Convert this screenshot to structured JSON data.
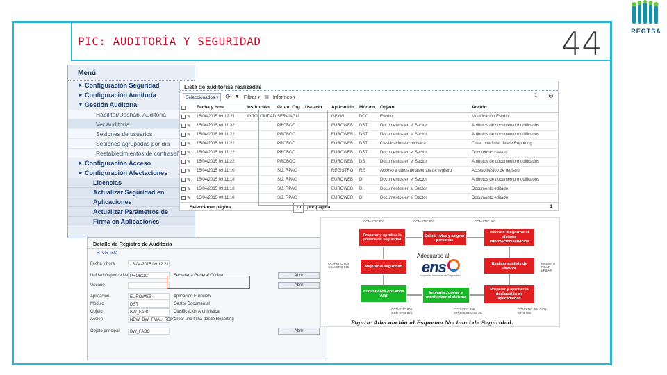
{
  "slide": {
    "title": "PIC: AUDITORÍA Y SEGURIDAD",
    "page_number": "44",
    "logo_text": "REGTSA",
    "colors": {
      "frame": "#2bb6d4",
      "title": "#c4122f"
    }
  },
  "menu": {
    "title": "Menú",
    "items": [
      {
        "label": "Configuración Seguridad",
        "type": "collapsed"
      },
      {
        "label": "Configuración Auditoría",
        "type": "collapsed"
      },
      {
        "label": "Gestión Auditoría",
        "type": "expanded"
      },
      {
        "label": "Habilitar/Deshab. Auditoría",
        "type": "sub"
      },
      {
        "label": "Ver Auditoría",
        "type": "sub-selected"
      },
      {
        "label": "Sesiones de usuarios",
        "type": "sub"
      },
      {
        "label": "Sesiones agrupadas por día",
        "type": "sub"
      },
      {
        "label": "Restablecimientos de contraseña",
        "type": "sub"
      },
      {
        "label": "Configuración Acceso",
        "type": "collapsed"
      },
      {
        "label": "Configuración Afectaciones",
        "type": "collapsed"
      },
      {
        "label": "Licencias",
        "type": "plain"
      },
      {
        "label": "Actualizar Seguridad en",
        "type": "plain"
      },
      {
        "label": "Aplicaciones",
        "type": "plain"
      },
      {
        "label": "Actualizar Parámetros de",
        "type": "plain"
      },
      {
        "label": "Firma en Aplicaciones",
        "type": "plain"
      }
    ]
  },
  "audit_list": {
    "title": "Lista de auditorías realizadas",
    "toolbar": {
      "select_label": "Seleccionados ▾",
      "filter_label": "Filtrar ▾",
      "reports_label": "Informes ▾",
      "page": "1",
      "gear_icon": "gear-icon"
    },
    "columns": [
      "Fecha y hora",
      "Institución",
      "Grupo Org.",
      "Usuario",
      "Aplicación",
      "Módulo",
      "Objeto",
      "Acción"
    ],
    "rows": [
      [
        "15/04/2015 09:12:21",
        "AYTO. CIUDAD",
        "SERVIAGUI",
        "",
        "GEYW",
        "DOC",
        "Escrito",
        "Modificación Escrito"
      ],
      [
        "15/04/2015 09:11:32",
        "",
        "PROBOC",
        "",
        "EUROWEB",
        "DST",
        "Documentos en el Sector",
        "Atributos de documento modificados"
      ],
      [
        "15/04/2015 09:11:22",
        "",
        "PROBOC",
        "",
        "EUROWEB",
        "DST",
        "Documentos en el Sector",
        "Atributos de documento modificados"
      ],
      [
        "15/04/2015 09:11:22",
        "",
        "PROBOC",
        "",
        "EUROWEB",
        "DST",
        "Clasificación Archivística",
        "Crear una ficha desde Reporting"
      ],
      [
        "15/04/2015 09:11:22",
        "",
        "PROBOC",
        "",
        "EUROWEB",
        "DST",
        "Documentos en el Sector",
        "Documento creado"
      ],
      [
        "15/04/2015 09:11:22",
        "",
        "PROBOC",
        "",
        "EUROWEB",
        "DS",
        "Documentos en el Sector",
        "Atributos de documento modificados"
      ],
      [
        "15/04/2015 09:11:10",
        "",
        "SIJ. RPAC",
        "",
        "REGISTRO",
        "RE",
        "Acceso a datos de asientos de registro",
        "Acceso básico de registro"
      ],
      [
        "15/04/2015 09:11:18",
        "",
        "SIJ. RPAC",
        "",
        "EUROWEB",
        "DI",
        "Documentos en el Sector",
        "Atributos de documento modificados"
      ],
      [
        "15/04/2015 09:11:18",
        "",
        "SIJ. RPAC",
        "",
        "EUROWEB",
        "DI",
        "Documentos en el Sector",
        "Documento editado"
      ],
      [
        "15/04/2015 09:11:18",
        "",
        "SIJ. RPAC",
        "",
        "EUROWEB",
        "DI",
        "Documentos en el Sector",
        "Documento editado"
      ]
    ],
    "footer": {
      "select_pages_label": "Seleccionar página",
      "per_page_value": "10",
      "per_page_label": "por página",
      "page": "1"
    }
  },
  "detail": {
    "title": "Detalle de Registro de Auditoría",
    "back_label": "Ver lista",
    "fields": [
      {
        "label": "Fecha y hora",
        "value": "15-04-2015 09:12:21",
        "desc": ""
      },
      {
        "label": "Unidad Organizativa",
        "value": "PROBOC",
        "desc": "Secretaría General Oficina",
        "button": "Abrir"
      },
      {
        "label": "Usuario",
        "value": "",
        "desc": "",
        "button": "Abrir"
      },
      {
        "label": "Aplicación",
        "value": "EUROWEB",
        "desc": "Aplicación Euroweb",
        "button": ""
      },
      {
        "label": "Módulo",
        "value": "DST",
        "desc": "Gestor Documental",
        "button": ""
      },
      {
        "label": "Objeto",
        "value": "BW_FABC",
        "desc": "Clasificación Archivística",
        "button": ""
      },
      {
        "label": "Acción",
        "value": "NEW_BW_FMAL_REPT",
        "desc": "Crear una ficha desde Reporting",
        "button": ""
      },
      {
        "label": "Objeto principal",
        "value": "BW_FABC",
        "desc": "",
        "button": "Abrir"
      }
    ]
  },
  "ens_diagram": {
    "caption": "Figura: Adecuación al Esquema Nacional de Seguridad.",
    "logo_heading": "Adecuarse al",
    "logo_word": "ens",
    "logo_sub": "Esquema Nacional de Seguridad",
    "boxes": [
      {
        "id": "politica",
        "label": "Preparar y aprobar la política de seguridad",
        "color": "red"
      },
      {
        "id": "roles",
        "label": "Definir roles y asignar personas",
        "color": "red"
      },
      {
        "id": "categorizar",
        "label": "Valorar/Categorizar el sistema información/servicios",
        "color": "red"
      },
      {
        "id": "mejorar",
        "label": "Mejorar la seguridad",
        "color": "red"
      },
      {
        "id": "riesgos",
        "label": "Realizar análisis de riesgos",
        "color": "red"
      },
      {
        "id": "auditar",
        "label": "Auditar cada dos años (A/M)",
        "color": "green"
      },
      {
        "id": "implantar",
        "label": "Implantar, operar y monitorizar el sistema",
        "color": "green"
      },
      {
        "id": "declaracion",
        "label": "Preparar y aprobar la declaración de aplicabilidad",
        "color": "red"
      }
    ],
    "side_labels": {
      "top_left": "CCN-STIC 801",
      "top_mid": "CCN-STIC 802",
      "top_right": "CCN-STIC 803",
      "left_mid": "CCN-STIC 804 CCN-STIC 815",
      "right_mid": "MAGERIT PILAR µPILAR",
      "bottom_left": "CCN-STIC 802 CCN-STIC 824",
      "bottom_mid": "CCN-STIC 806 807,808,812,813 etc.",
      "bottom_right": "CCN-STIC 804 CCN-STIC 805"
    }
  }
}
